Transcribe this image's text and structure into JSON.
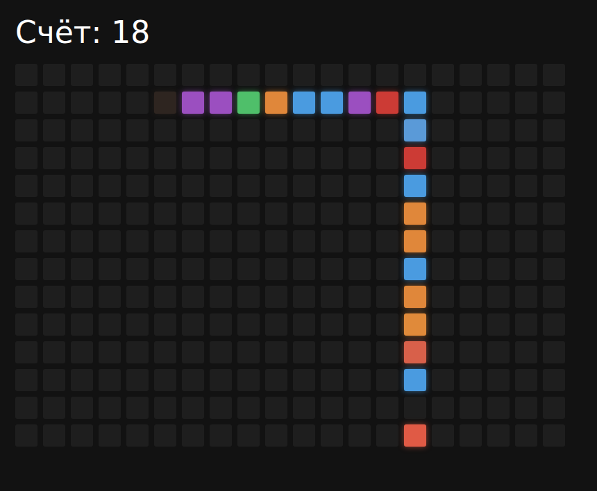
{
  "score": "Счёт: 18",
  "board": {
    "columns": 20,
    "rows": 14
  },
  "snake": [
    {
      "col": 5,
      "row": 1,
      "color": "#2e2520"
    },
    {
      "col": 6,
      "row": 1,
      "color": "#9b4fc0"
    },
    {
      "col": 7,
      "row": 1,
      "color": "#9b4fc0"
    },
    {
      "col": 8,
      "row": 1,
      "color": "#4fbf6a"
    },
    {
      "col": 9,
      "row": 1,
      "color": "#e0873a"
    },
    {
      "col": 10,
      "row": 1,
      "color": "#4a9be0"
    },
    {
      "col": 11,
      "row": 1,
      "color": "#4a9be0"
    },
    {
      "col": 12,
      "row": 1,
      "color": "#9b4fc0"
    },
    {
      "col": 13,
      "row": 1,
      "color": "#cc3b35"
    },
    {
      "col": 14,
      "row": 1,
      "color": "#4a9be0"
    },
    {
      "col": 14,
      "row": 2,
      "color": "#5a9ad8"
    },
    {
      "col": 14,
      "row": 3,
      "color": "#cc3b35"
    },
    {
      "col": 14,
      "row": 4,
      "color": "#4a9be0"
    },
    {
      "col": 14,
      "row": 5,
      "color": "#e0873a"
    },
    {
      "col": 14,
      "row": 6,
      "color": "#e0873a"
    },
    {
      "col": 14,
      "row": 7,
      "color": "#4a9be0"
    },
    {
      "col": 14,
      "row": 8,
      "color": "#e0873a"
    },
    {
      "col": 14,
      "row": 9,
      "color": "#e08a3a"
    },
    {
      "col": 14,
      "row": 10,
      "color": "#d8604a"
    },
    {
      "col": 14,
      "row": 11,
      "color": "#4a9be0"
    }
  ],
  "food": {
    "col": 14,
    "row": 13,
    "color": "#e05a45"
  }
}
